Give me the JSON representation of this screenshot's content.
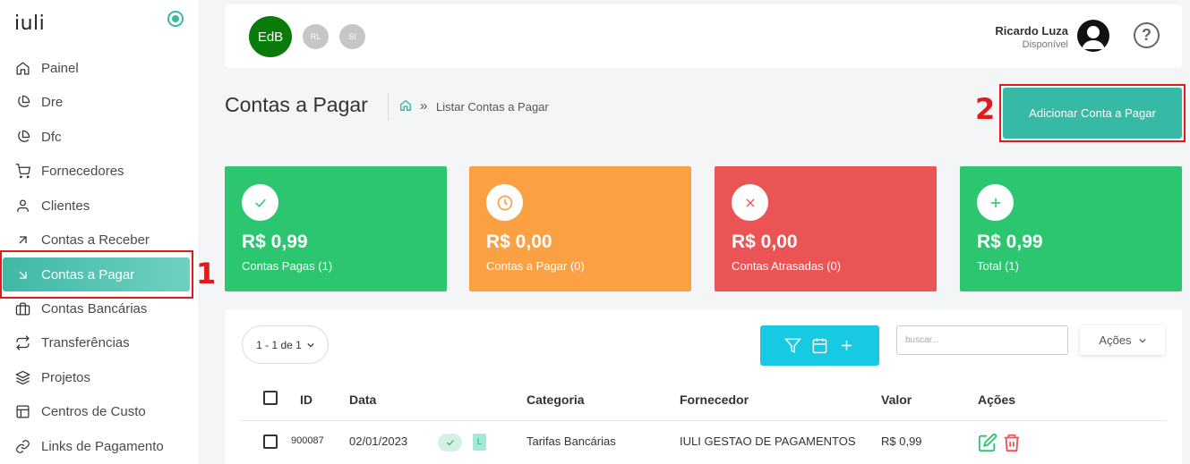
{
  "brand": {
    "logo": "iuli"
  },
  "sidebar": {
    "items": [
      {
        "label": "Painel",
        "icon": "home-icon"
      },
      {
        "label": "Dre",
        "icon": "pie-chart-icon"
      },
      {
        "label": "Dfc",
        "icon": "pie-chart-icon"
      },
      {
        "label": "Fornecedores",
        "icon": "cart-icon"
      },
      {
        "label": "Clientes",
        "icon": "user-icon"
      },
      {
        "label": "Contas a Receber",
        "icon": "arrow-up-right-icon"
      },
      {
        "label": "Contas a Pagar",
        "icon": "arrow-down-right-icon",
        "active": true
      },
      {
        "label": "Contas Bancárias",
        "icon": "briefcase-icon"
      },
      {
        "label": "Transferências",
        "icon": "repeat-icon"
      },
      {
        "label": "Projetos",
        "icon": "layers-icon"
      },
      {
        "label": "Centros de Custo",
        "icon": "layout-icon"
      },
      {
        "label": "Links de Pagamento",
        "icon": "link-icon"
      }
    ]
  },
  "markers": {
    "one": "1",
    "two": "2"
  },
  "header": {
    "avatars": [
      "EdB",
      "RL",
      "SI"
    ],
    "user_name": "Ricardo Luza",
    "user_status": "Disponível",
    "help": "?"
  },
  "page": {
    "title": "Contas a Pagar",
    "breadcrumb_sep": "»",
    "breadcrumb": "Listar Contas a Pagar",
    "add_button": "Adicionar Conta a Pagar"
  },
  "stats": [
    {
      "amount": "R$ 0,99",
      "label": "Contas Pagas (1)",
      "color": "#2bc66f",
      "icon": "check-icon"
    },
    {
      "amount": "R$ 0,00",
      "label": "Contas a Pagar (0)",
      "color": "#fba043",
      "icon": "clock-icon"
    },
    {
      "amount": "R$ 0,00",
      "label": "Contas Atrasadas (0)",
      "color": "#ea5455",
      "icon": "x-icon"
    },
    {
      "amount": "R$ 0,99",
      "label": "Total (1)",
      "color": "#2bc66f",
      "icon": "plus-icon"
    }
  ],
  "table": {
    "pager": "1 - 1 de 1",
    "search_placeholder": "buscar...",
    "actions_label": "Ações",
    "columns": [
      "ID",
      "Data",
      "Categoria",
      "Fornecedor",
      "Valor",
      "Ações"
    ],
    "rows": [
      {
        "id": "900087",
        "date": "02/01/2023",
        "badge": "L",
        "category": "Tarifas Bancárias",
        "supplier": "IULI GESTAO DE PAGAMENTOS",
        "value": "R$ 0,99"
      }
    ]
  }
}
